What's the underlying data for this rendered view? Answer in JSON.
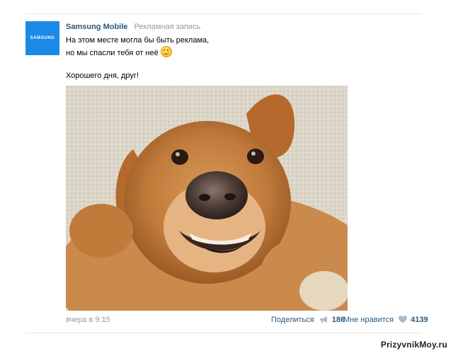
{
  "post": {
    "author": "Samsung Mobile",
    "ad_label": "Рекламная запись",
    "logo_text": "SAMSUNG",
    "text_lines": [
      "На этом месте могла бы быть реклама,",
      "но мы спасли тебя от неё",
      "Хорошего дня, друг!"
    ],
    "emoji": "winking-face",
    "photo_subject": "dog"
  },
  "footer": {
    "date": "вчера в 9:15",
    "share_label": "Поделиться",
    "share_count": "186",
    "like_label": "Мне нравится",
    "like_count": "4139"
  },
  "watermark": "PrizyvnikMoy.ru",
  "colors": {
    "link": "#2b587a",
    "muted": "#999999",
    "samsung_blue": "#1a8ae6",
    "divider": "#e1e4e8"
  }
}
